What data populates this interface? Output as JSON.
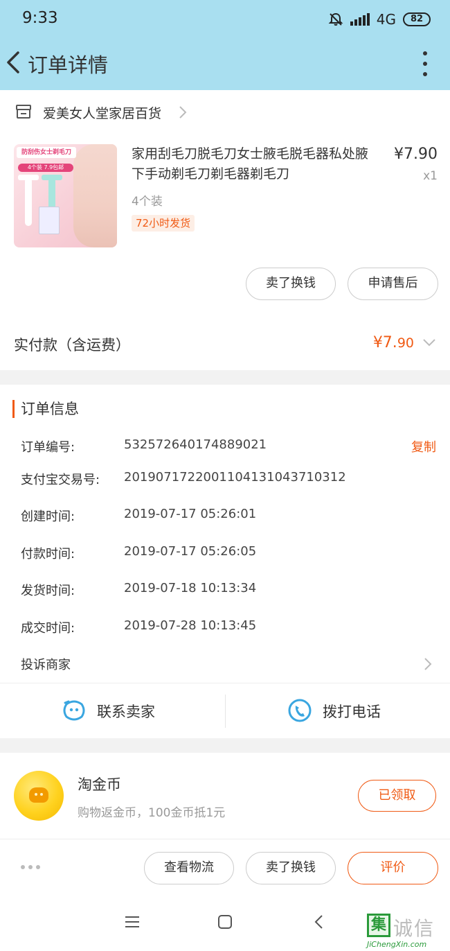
{
  "status_bar": {
    "time": "9:33",
    "network": "4G",
    "battery": "82"
  },
  "nav": {
    "title": "订单详情",
    "back_icon": "chevron-left-icon",
    "more_icon": "more-vertical-icon"
  },
  "shop": {
    "name": "爱美女人堂家居百货",
    "icon": "store-icon"
  },
  "product": {
    "title": "家用刮毛刀脱毛刀女士腋毛脱毛器私处腋下手动剃毛刀剃毛器剃毛刀",
    "sku": "4个装",
    "shipping_tag": "72小时发货",
    "price": "¥7.90",
    "quantity": "x1",
    "thumb_banner": "防刮伤女士剃毛刀",
    "thumb_tag": "4个装 7.9包邮"
  },
  "item_actions": {
    "sell_label": "卖了换钱",
    "aftersale_label": "申请售后"
  },
  "payment": {
    "label": "实付款（含运费）",
    "amount_main": "¥7.",
    "amount_cents": "90"
  },
  "order_info": {
    "heading": "订单信息",
    "rows": [
      {
        "key": "订单编号:",
        "value": "532572640174889021"
      },
      {
        "key": "支付宝交易号:",
        "value": "2019071722001104131043710312"
      },
      {
        "key": "创建时间:",
        "value": "2019-07-17 05:26:01"
      },
      {
        "key": "付款时间:",
        "value": "2019-07-17 05:26:05"
      },
      {
        "key": "发货时间:",
        "value": "2019-07-18 10:13:34"
      },
      {
        "key": "成交时间:",
        "value": "2019-07-28 10:13:45"
      }
    ],
    "copy_label": "复制",
    "complain_label": "投诉商家"
  },
  "contact": {
    "seller_label": "联系卖家",
    "phone_label": "拨打电话"
  },
  "coins": {
    "title": "淘金币",
    "subtitle": "购物返金币，100金币抵1元",
    "claim_label": "已领取"
  },
  "bottom_actions": {
    "logistics_label": "查看物流",
    "sell_label": "卖了换钱",
    "review_label": "评价"
  },
  "watermark": {
    "logo": "集",
    "cn": "诚信",
    "en": "JiChengXin.com"
  },
  "colors": {
    "accent": "#f05a14",
    "header_bg": "#a9dff0",
    "contact_blue": "#3aa6e0"
  }
}
